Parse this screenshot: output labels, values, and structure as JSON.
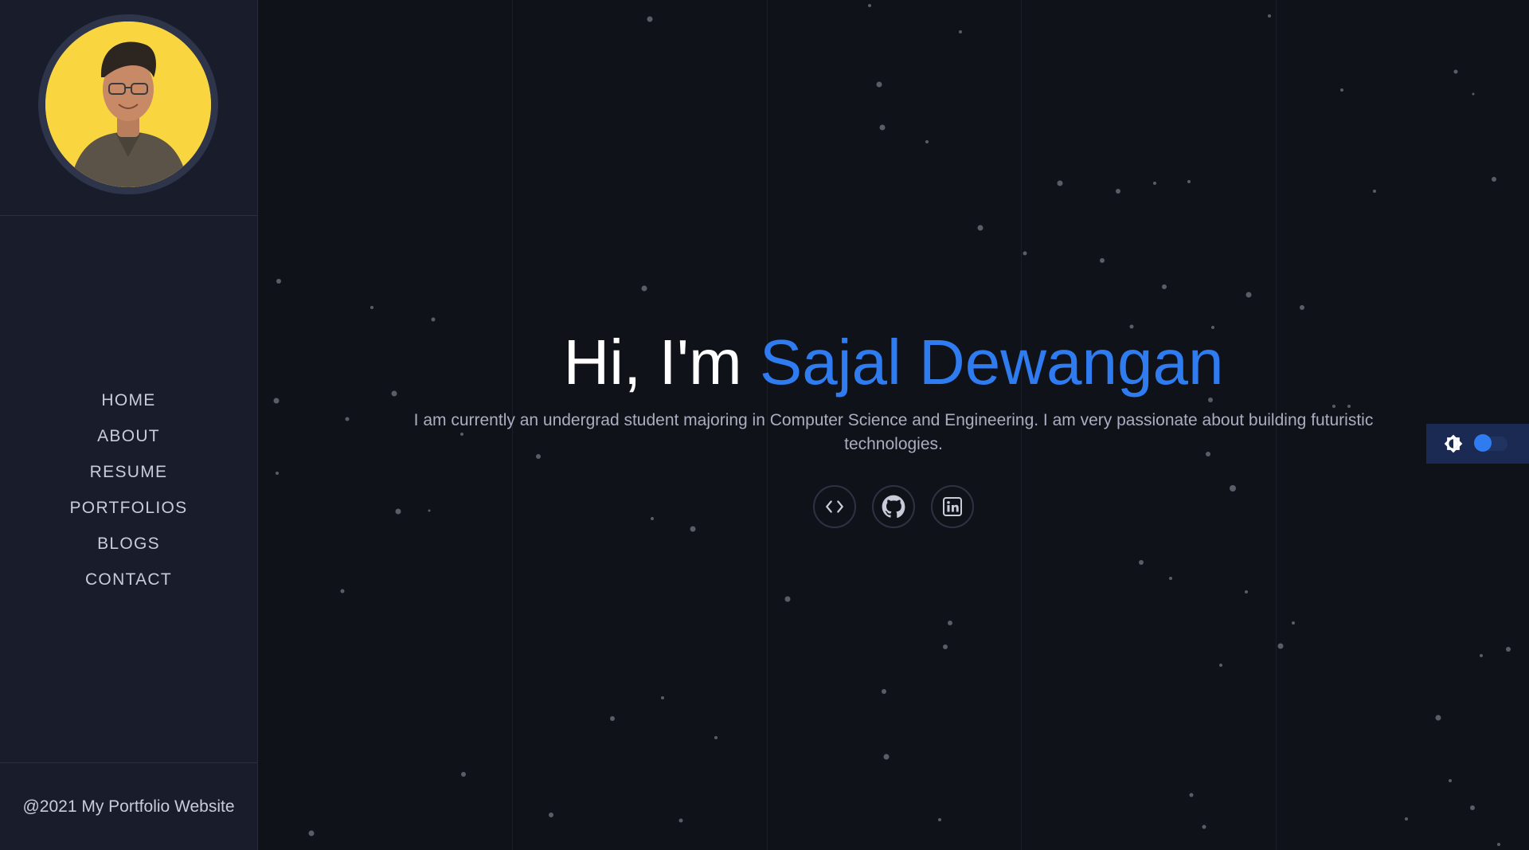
{
  "sidebar": {
    "nav": [
      {
        "label": "HOME"
      },
      {
        "label": "ABOUT"
      },
      {
        "label": "RESUME"
      },
      {
        "label": "PORTFOLIOS"
      },
      {
        "label": "BLOGS"
      },
      {
        "label": "CONTACT"
      }
    ],
    "footer": "@2021 My Portfolio Website"
  },
  "hero": {
    "greeting": "Hi, I'm ",
    "name": "Sajal Dewangan",
    "description": "I am currently an undergrad student majoring in Computer Science and Engineering. I am very passionate about building futuristic technologies."
  },
  "socials": [
    {
      "icon": "code-icon"
    },
    {
      "icon": "github-icon"
    },
    {
      "icon": "linkedin-icon"
    }
  ],
  "theme": {
    "icon": "brightness-icon",
    "dark_mode": true
  },
  "colors": {
    "accent": "#2f7bf0",
    "background": "#10121a",
    "sidebar": "#191d2b"
  }
}
